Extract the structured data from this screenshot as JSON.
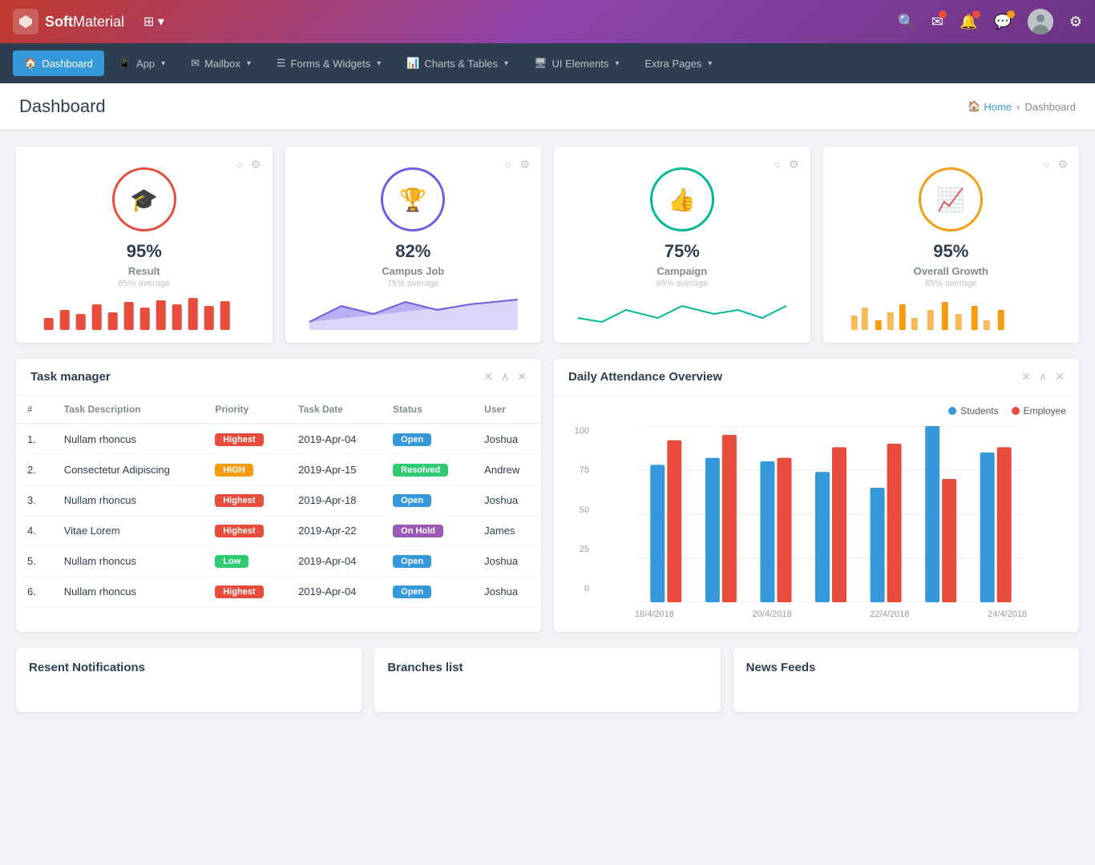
{
  "brand": {
    "name_bold": "Soft",
    "name_light": "Material"
  },
  "top_icons": [
    {
      "name": "search-icon",
      "symbol": "🔍"
    },
    {
      "name": "mail-icon",
      "symbol": "✉",
      "badge": true,
      "badge_color": "red"
    },
    {
      "name": "bell-icon",
      "symbol": "🔔",
      "badge": true,
      "badge_color": "red"
    },
    {
      "name": "chat-icon",
      "symbol": "💬",
      "badge": true,
      "badge_color": "orange"
    },
    {
      "name": "settings-icon",
      "symbol": "⚙"
    }
  ],
  "nav": {
    "items": [
      {
        "label": "Dashboard",
        "icon": "🏠",
        "active": true
      },
      {
        "label": "App",
        "icon": "📱",
        "has_dropdown": true
      },
      {
        "label": "Mailbox",
        "icon": "✉",
        "has_dropdown": true
      },
      {
        "label": "Forms & Widgets",
        "icon": "☰",
        "has_dropdown": true
      },
      {
        "label": "Charts & Tables",
        "icon": "📊",
        "has_dropdown": true
      },
      {
        "label": "UI Elements",
        "icon": "🖥",
        "has_dropdown": true
      },
      {
        "label": "Extra Pages",
        "icon": "",
        "has_dropdown": true
      }
    ]
  },
  "breadcrumb": {
    "page_title": "Dashboard",
    "home_label": "Home",
    "current_label": "Dashboard"
  },
  "stat_cards": [
    {
      "id": "result",
      "value": "95%",
      "label": "Result",
      "avg": "85% average",
      "icon": "🎓",
      "color": "#e74c3c",
      "bars": [
        3,
        5,
        4,
        7,
        5,
        8,
        6,
        9,
        8,
        10,
        7,
        9
      ]
    },
    {
      "id": "campus-job",
      "value": "82%",
      "label": "Campus Job",
      "avg": "75% average",
      "icon": "🏆",
      "color": "#6c5ce7",
      "bars": [
        5,
        8,
        6,
        9,
        7,
        10,
        8,
        9,
        7,
        8,
        9,
        10
      ]
    },
    {
      "id": "campaign",
      "value": "75%",
      "label": "Campaign",
      "avg": "65% average",
      "icon": "👍",
      "color": "#00b894",
      "bars": [
        6,
        7,
        5,
        8,
        6,
        9,
        7,
        8,
        6,
        9,
        8,
        7
      ]
    },
    {
      "id": "overall-growth",
      "value": "95%",
      "label": "Overall Growth",
      "avg": "85% average",
      "icon": "📈",
      "color": "#f39c12",
      "bars": [
        4,
        6,
        5,
        7,
        6,
        8,
        5,
        9,
        7,
        8,
        6,
        9
      ]
    }
  ],
  "task_manager": {
    "title": "Task manager",
    "columns": [
      "#",
      "Task Description",
      "Priority",
      "Task Date",
      "Status",
      "User"
    ],
    "rows": [
      {
        "num": "1.",
        "desc": "Nullam rhoncus",
        "priority": "Highest",
        "priority_color": "bg-red",
        "date": "2019-Apr-04",
        "status": "Open",
        "status_color": "status-open",
        "user": "Joshua"
      },
      {
        "num": "2.",
        "desc": "Consectetur Adipiscing",
        "priority": "HIGH",
        "priority_color": "bg-orange",
        "date": "2019-Apr-15",
        "status": "Resolved",
        "status_color": "status-resolved",
        "user": "Andrew"
      },
      {
        "num": "3.",
        "desc": "Nullam rhoncus",
        "priority": "Highest",
        "priority_color": "bg-red",
        "date": "2019-Apr-18",
        "status": "Open",
        "status_color": "status-open",
        "user": "Joshua"
      },
      {
        "num": "4.",
        "desc": "Vitae Lorem",
        "priority": "Highest",
        "priority_color": "bg-red",
        "date": "2019-Apr-22",
        "status": "On Hold",
        "status_color": "status-onhold",
        "user": "James"
      },
      {
        "num": "5.",
        "desc": "Nullam rhoncus",
        "priority": "Low",
        "priority_color": "bg-low",
        "date": "2019-Apr-04",
        "status": "Open",
        "status_color": "status-open",
        "user": "Joshua"
      },
      {
        "num": "6.",
        "desc": "Nullam rhoncus",
        "priority": "Highest",
        "priority_color": "bg-red",
        "date": "2019-Apr-04",
        "status": "Open",
        "status_color": "status-open",
        "user": "Joshua"
      }
    ]
  },
  "attendance": {
    "title": "Daily Attendance Overview",
    "legend": {
      "students_label": "Students",
      "employee_label": "Employee",
      "students_color": "#3498db",
      "employee_color": "#e74c3c"
    },
    "y_labels": [
      "100",
      "75",
      "50",
      "25",
      "0"
    ],
    "x_labels": [
      "18/4/2018",
      "20/4/2018",
      "22/4/2018",
      "24/4/2018"
    ],
    "bar_groups": [
      {
        "students": 78,
        "employee": 92
      },
      {
        "students": 82,
        "employee": 95
      },
      {
        "students": 80,
        "employee": 82
      },
      {
        "students": 74,
        "employee": 88
      },
      {
        "students": 65,
        "employee": 90
      },
      {
        "students": 100,
        "employee": 70
      },
      {
        "students": 85,
        "employee": 88
      }
    ]
  },
  "bottom_panels": [
    {
      "title": "Resent Notifications"
    },
    {
      "title": "Branches list"
    },
    {
      "title": "News Feeds"
    }
  ]
}
